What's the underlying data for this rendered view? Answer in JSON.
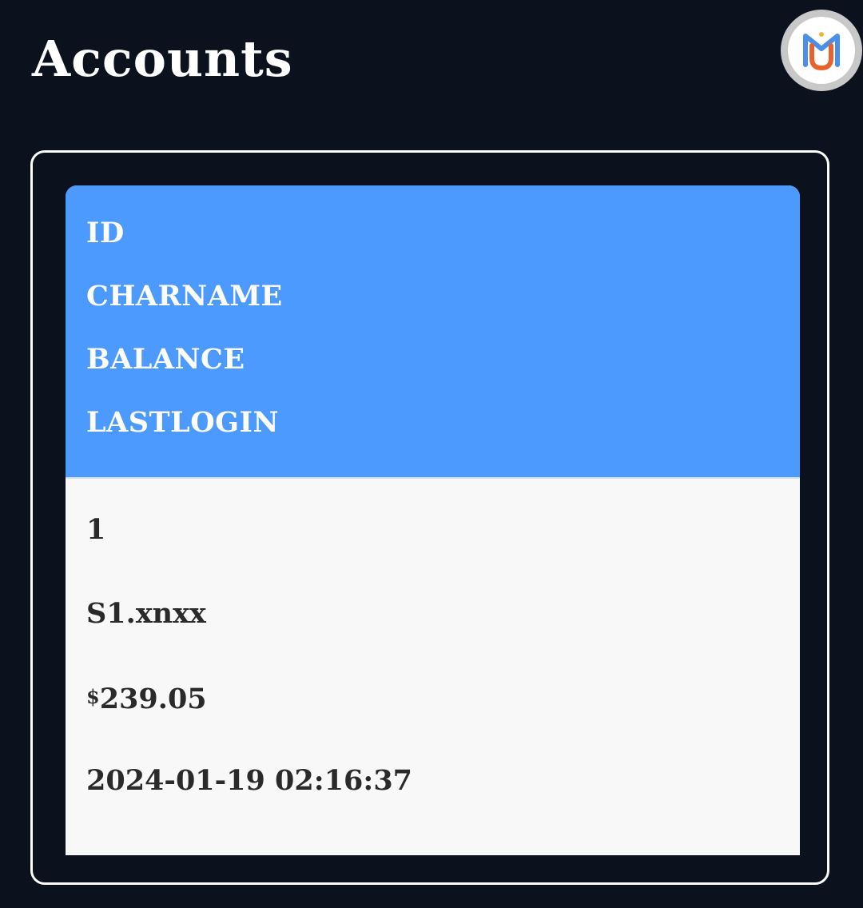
{
  "header": {
    "title": "Accounts",
    "avatar_icon": "brand-logo-icon"
  },
  "table": {
    "columns": [
      "ID",
      "CHARNAME",
      "BALANCE",
      "LASTLOGIN"
    ],
    "rows": [
      {
        "id": "1",
        "charname": "S1.xnxx",
        "balance_symbol": "$",
        "balance_amount": "239.05",
        "lastlogin": "2024-01-19 02:16:37"
      }
    ]
  },
  "colors": {
    "background": "#0b111d",
    "header_accent": "#4d9aff",
    "row_background": "#f8f8f8",
    "text_dark": "#2a2a2a",
    "logo_blue": "#4a8fe8",
    "logo_orange": "#e8632b"
  }
}
